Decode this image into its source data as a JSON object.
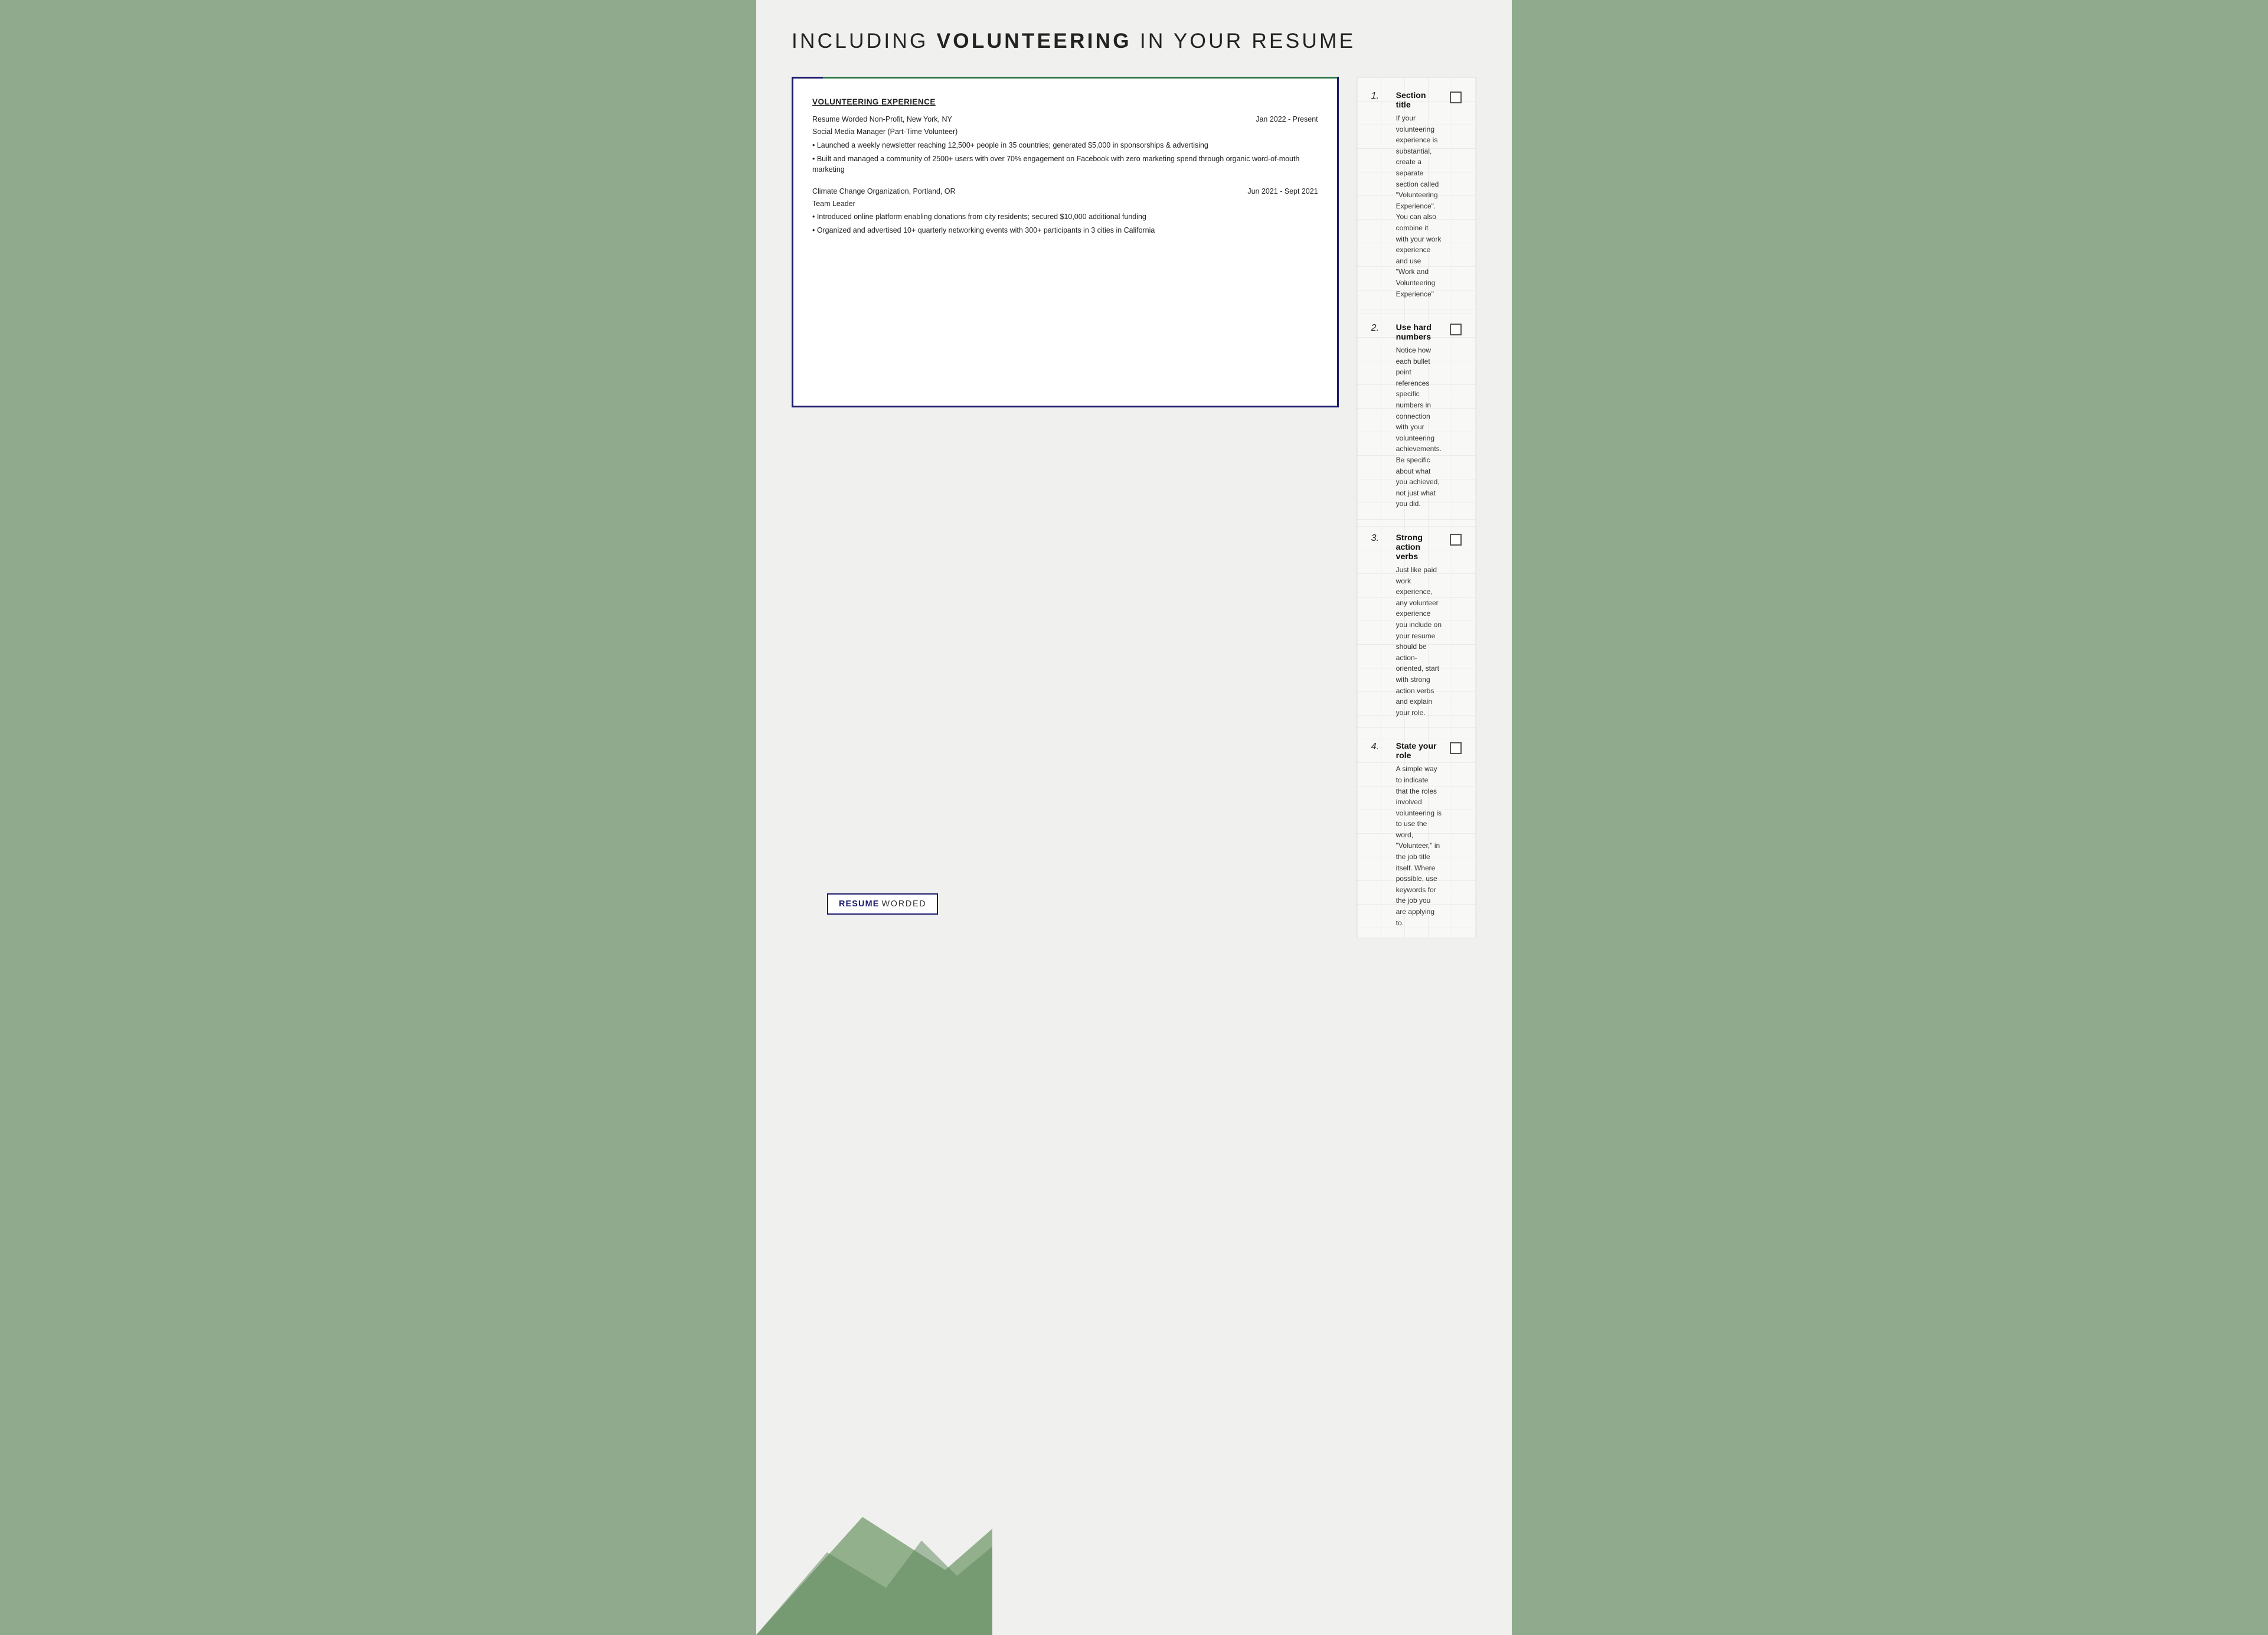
{
  "page": {
    "title_prefix": "INCLUDING ",
    "title_bold": "VOLUNTEERING",
    "title_suffix": " IN YOUR RESUME",
    "background_color": "#8faa8c",
    "card_border_color": "#1a1a6e"
  },
  "resume": {
    "section_title": "VOLUNTEERING EXPERIENCE",
    "jobs": [
      {
        "organization": "Resume Worded Non-Profit, New York, NY",
        "date": "Jan 2022 - Present",
        "role": "Social Media Manager (Part-Time Volunteer)",
        "bullets": [
          "• Launched a weekly newsletter reaching 12,500+ people in 35 countries; generated $5,000 in sponsorships & advertising",
          "• Built and managed a community of 2500+ users with over 70% engagement on Facebook with zero marketing spend through organic word-of-mouth marketing"
        ]
      },
      {
        "organization": "Climate Change Organization, Portland, OR",
        "date": "Jun 2021 - Sept 2021",
        "role": "Team Leader",
        "bullets": [
          "• Introduced online platform enabling donations from city residents; secured $10,000 additional funding",
          "• Organized and advertised 10+ quarterly networking events with 300+ participants in 3 cities in California"
        ]
      }
    ]
  },
  "tips": [
    {
      "number": "1.",
      "title": "Section title",
      "description": "If your volunteering experience is substantial, create a separate section called \"Volunteering Experience\". You can also combine it with your work experience and use \"Work and Volunteering Experience\""
    },
    {
      "number": "2.",
      "title": "Use hard numbers",
      "description": "Notice how each bullet point references specific numbers in connection with your volunteering achievements. Be specific about what you achieved, not just what you did."
    },
    {
      "number": "3.",
      "title": "Strong action verbs",
      "description": "Just like paid work experience, any volunteer experience you include on your resume should be action-oriented, start with strong action verbs and explain your role."
    },
    {
      "number": "4.",
      "title": "State your role",
      "description": "A simple way to indicate that the roles involved volunteering is to use the word, \"Volunteer,\" in the job title itself. Where possible, use keywords for the job you are applying to."
    }
  ],
  "logo": {
    "resume": "RESUME",
    "worded": "WORDED"
  }
}
